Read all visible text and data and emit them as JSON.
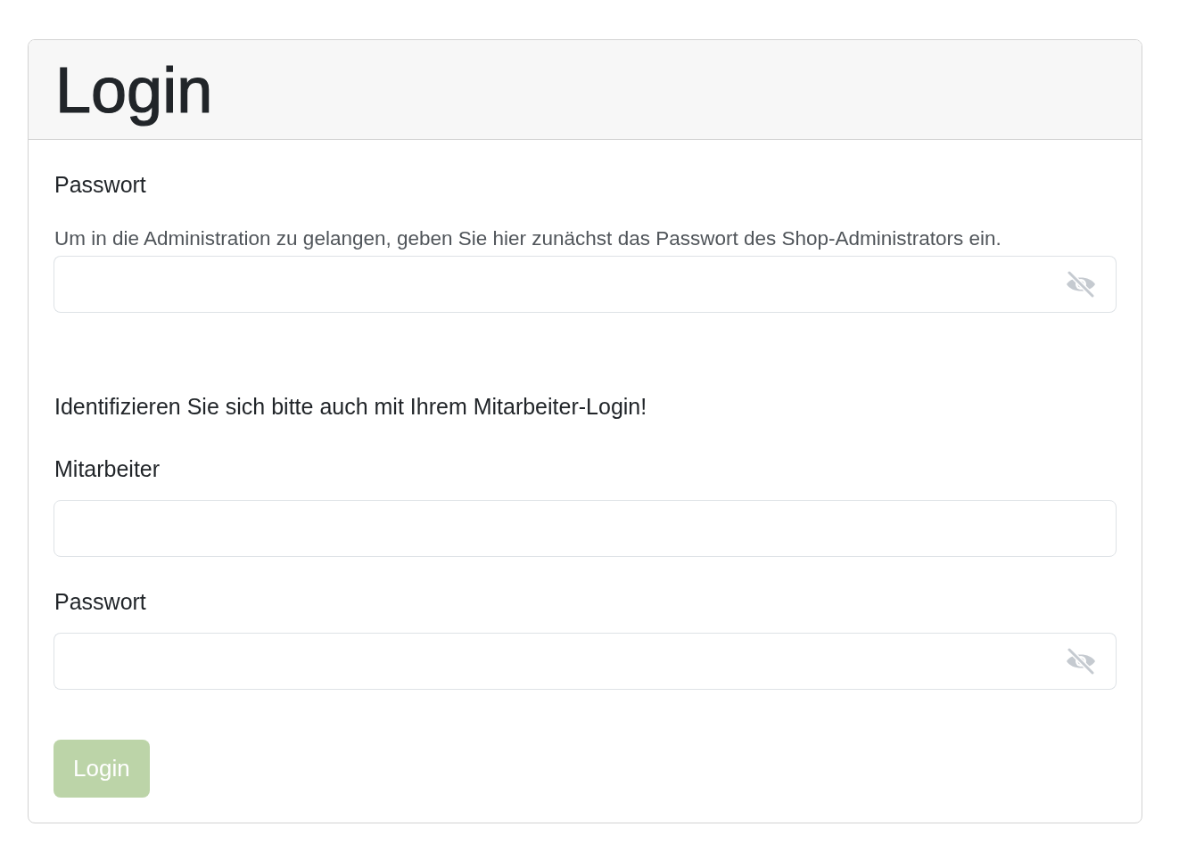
{
  "card": {
    "title": "Login"
  },
  "admin_section": {
    "label": "Passwort",
    "help": "Um in die Administration zu gelangen, geben Sie hier zunächst das Passwort des Shop-Administrators ein.",
    "field": {
      "kind": "password"
    }
  },
  "staff_section": {
    "intro": "Identifizieren Sie sich bitte auch mit Ihrem Mitarbeiter-Login!",
    "fields": [
      {
        "label": "Mitarbeiter",
        "kind": "text"
      },
      {
        "label": "Passwort",
        "kind": "password"
      }
    ]
  },
  "submit_button": {
    "label": "Login",
    "disabled": true
  }
}
